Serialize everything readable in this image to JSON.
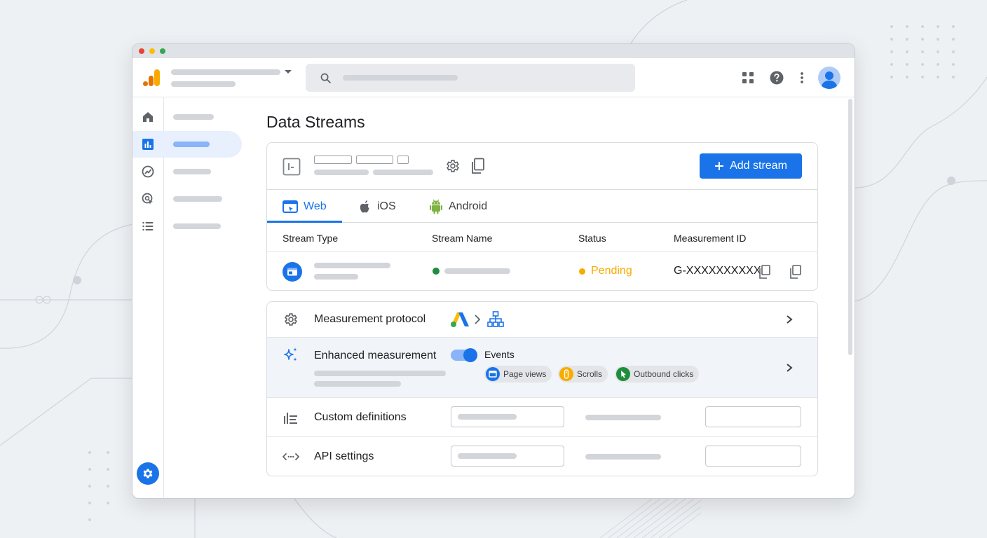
{
  "app": {
    "brand_colors": [
      "#f9ab00",
      "#e37400"
    ]
  },
  "header": {
    "search": {
      "icon": "search-icon"
    },
    "actions": [
      "apps-grid-icon",
      "help-icon",
      "more-vert-icon",
      "account-avatar"
    ]
  },
  "rail": {
    "items": [
      "home-icon",
      "reports-icon",
      "explore-icon",
      "advertising-icon",
      "configure-icon"
    ],
    "admin_icon": "settings-gear-icon"
  },
  "page": {
    "title": "Data Streams"
  },
  "stream_card": {
    "add_button": "Add stream",
    "tabs": [
      {
        "label": "Web",
        "icon": "web-window-icon",
        "active": true
      },
      {
        "label": "iOS",
        "icon": "apple-icon",
        "active": false
      },
      {
        "label": "Android",
        "icon": "android-icon",
        "active": false
      }
    ],
    "columns": [
      "Stream Type",
      "Stream Name",
      "Status",
      "Measurement ID"
    ],
    "row": {
      "status": "Pending",
      "measurement_id": "G-XXXXXXXXXX",
      "status_color": "#f9ab00",
      "name_dot_color": "#1e8e3e"
    }
  },
  "settings": {
    "measurement_protocol": {
      "label": "Measurement protocol"
    },
    "enhanced_measurement": {
      "label": "Enhanced measurement",
      "toggle_on": true,
      "events_label": "Events",
      "events": [
        {
          "label": "Page views",
          "color": "#1a73e8"
        },
        {
          "label": "Scrolls",
          "color": "#f9ab00"
        },
        {
          "label": "Outbound clicks",
          "color": "#1e8e3e"
        }
      ]
    },
    "custom_definitions": {
      "label": "Custom definitions"
    },
    "api_settings": {
      "label": "API settings"
    }
  }
}
